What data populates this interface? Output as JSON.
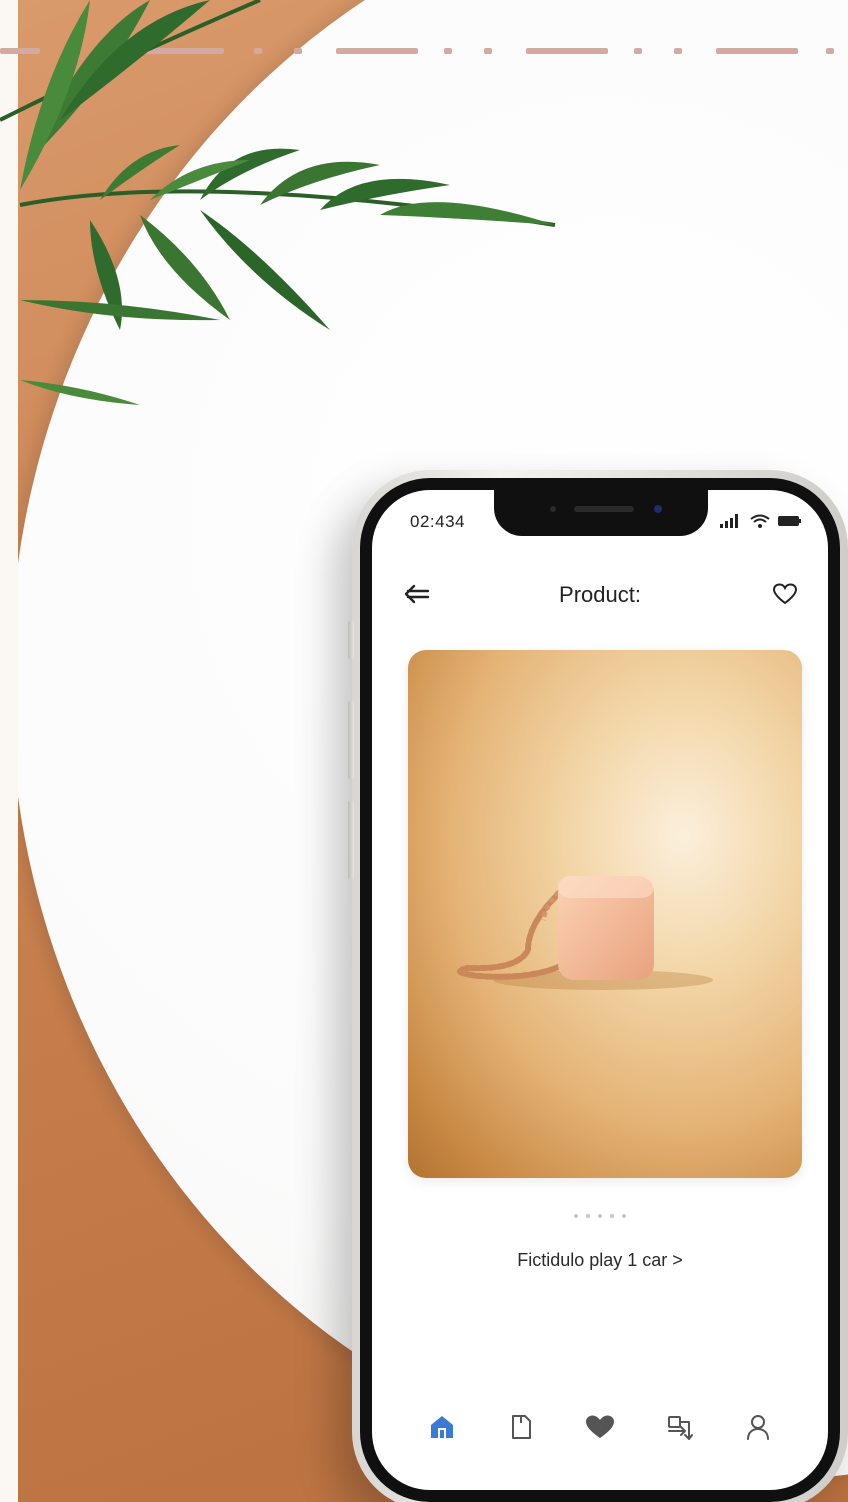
{
  "status_bar": {
    "time": "02:434",
    "signal_icon": "signal-icon",
    "wifi_icon": "wifi-icon",
    "battery_icon": "battery-icon"
  },
  "header": {
    "title": "Product:",
    "back_icon": "back-arrow-icon",
    "favorite_icon": "heart-outline-icon"
  },
  "product": {
    "image_icon": "product-photo",
    "pager_dots": 5,
    "caption": "Fictidulo play 1 car >"
  },
  "bottom_nav": {
    "items": [
      {
        "icon": "home-icon",
        "active": true
      },
      {
        "icon": "document-icon",
        "active": false
      },
      {
        "icon": "heart-filled-icon",
        "active": false
      },
      {
        "icon": "swap-icon",
        "active": false
      },
      {
        "icon": "profile-icon",
        "active": false
      }
    ]
  },
  "colors": {
    "accent": "#3a7bd5",
    "icon": "#555555",
    "terracotta": "#c9814f",
    "leaf": "#2f6b2c"
  }
}
